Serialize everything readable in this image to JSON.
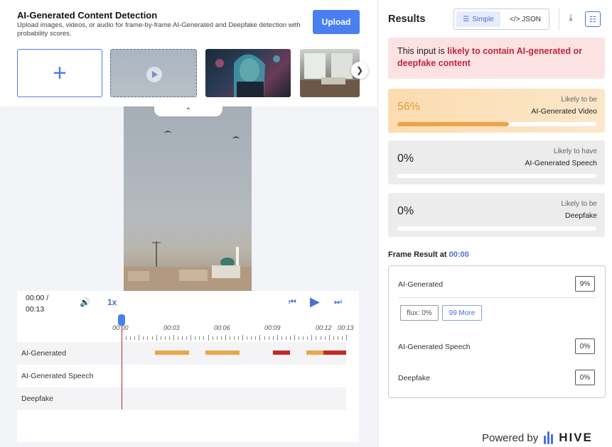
{
  "header": {
    "title": "AI-Generated Content Detection",
    "subtitle": "Upload images, videos, or audio for frame-by-frame AI-Generated and Deepfake detection with probability scores.",
    "upload_label": "Upload"
  },
  "player": {
    "time_current": "00:00 /",
    "time_total": "00:13",
    "speed": "1x",
    "ruler": [
      "00:00",
      "00:03",
      "00:06",
      "00:09",
      "00:12",
      "00:13"
    ],
    "tracks": [
      {
        "label": "AI-Generated"
      },
      {
        "label": "AI-Generated Speech"
      },
      {
        "label": "Deepfake"
      }
    ]
  },
  "results": {
    "title": "Results",
    "toggle_simple": "Simple",
    "toggle_json": "</> JSON",
    "verdict_prefix": "This input is ",
    "verdict_highlight": "likely to contain AI-generated or deepfake content",
    "scores": [
      {
        "value": "56%",
        "fraction": 0.56,
        "sub": "Likely to be",
        "main": "AI-Generated Video"
      },
      {
        "value": "0%",
        "fraction": 0.0,
        "sub": "Likely to have",
        "main": "AI-Generated Speech"
      },
      {
        "value": "0%",
        "fraction": 0.0,
        "sub": "Likely to be",
        "main": "Deepfake"
      }
    ],
    "frame_title": "Frame Result at ",
    "frame_time": "00:00",
    "frame_rows": [
      {
        "label": "AI-Generated",
        "value": "9%"
      },
      {
        "label": "AI-Generated Speech",
        "value": "0%"
      },
      {
        "label": "Deepfake",
        "value": "0%"
      }
    ],
    "chip_flux": "flux: 0%",
    "chip_more": "99 More"
  },
  "footer": {
    "powered_by": "Powered by",
    "brand": "HIVE"
  },
  "colors": {
    "accent": "#4a7ff0",
    "warning": "#eca44a",
    "danger": "#c0283b"
  }
}
